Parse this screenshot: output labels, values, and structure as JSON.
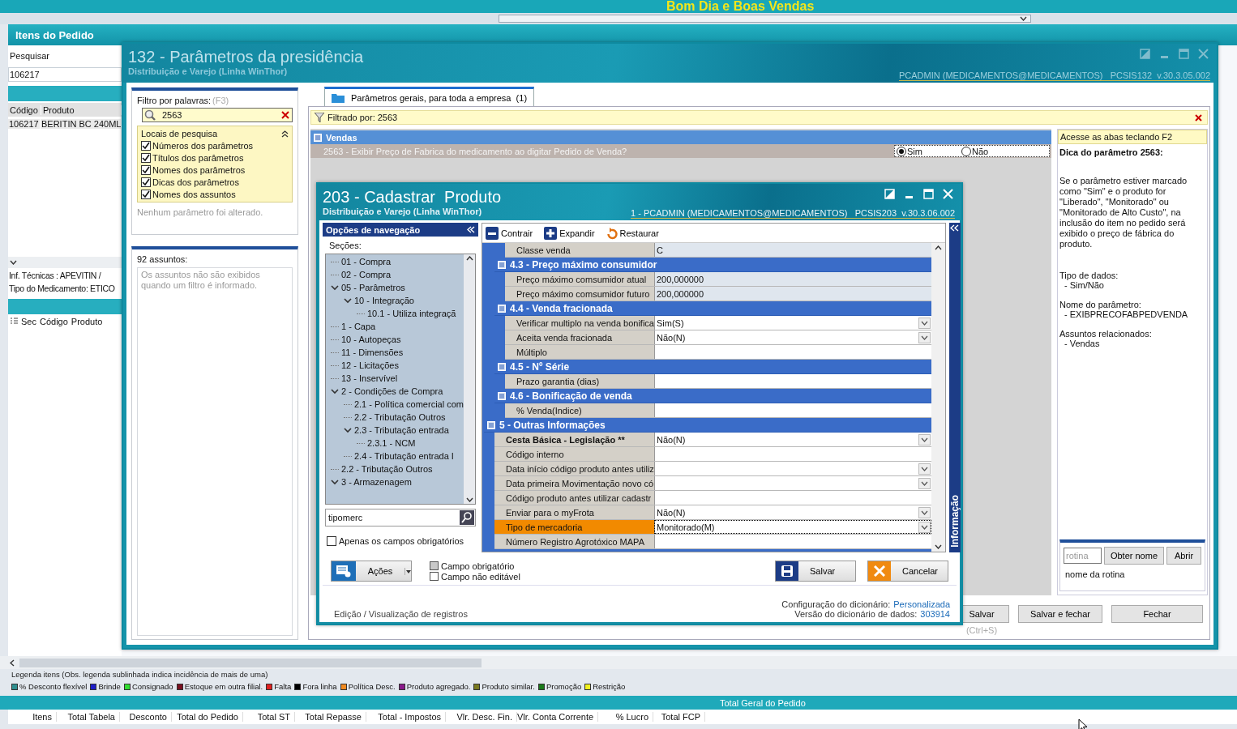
{
  "banner": {
    "title": "Bom Dia e Boas Vendas"
  },
  "background": {
    "header": "Itens do Pedido",
    "search_label": "Pesquisar",
    "search_value": "106217",
    "table": {
      "columns": [
        "Código",
        "Produto"
      ],
      "rows": [
        [
          "106217",
          "BERITIN BC 240ML"
        ]
      ]
    },
    "info": [
      "Inf. Técnicas : APEVITIN /",
      "Tipo do Medicamento: ETICO"
    ],
    "table2": {
      "columns": [
        "Sec",
        "Código",
        "Produto"
      ]
    }
  },
  "legend": {
    "title": "Legenda itens (Obs. legenda sublinhada indica incidência de mais de uma)",
    "items": [
      {
        "label": "% Desconto flexível",
        "color": "#2f8f8f"
      },
      {
        "label": "Brinde",
        "color": "#1e1ec8"
      },
      {
        "label": "Consignado",
        "color": "#33dd33"
      },
      {
        "label": "Estoque em outra filial.",
        "color": "#7a1020"
      },
      {
        "label": "Falta",
        "color": "#e02020"
      },
      {
        "label": "Fora linha",
        "color": "#000000"
      },
      {
        "label": "Política Desc.",
        "color": "#f08a20"
      },
      {
        "label": "Produto agregado.",
        "color": "#8a1a8a"
      },
      {
        "label": "Produto similar.",
        "color": "#7a7a20"
      },
      {
        "label": "Promoção",
        "color": "#1a7a1a"
      },
      {
        "label": "Restrição",
        "color": "#f0f020"
      }
    ]
  },
  "totals": {
    "title": "Total Geral do Pedido",
    "columns": [
      "Itens",
      "Total Tabela",
      "Desconto",
      "Total do Pedido",
      "Total ST",
      "Total Repasse",
      "Total - Impostos",
      "Vlr. Desc. Fin.",
      "Vlr. Conta Corrente",
      "% Lucro",
      "Total FCP"
    ]
  },
  "params_window": {
    "title": "132 - Parâmetros da presidência",
    "subtitle": "Distribuição e Varejo (Linha WinThor)",
    "user": "PCADMIN (MEDICAMENTOS@MEDICAMENTOS)   PCSIS132  v.30.3.05.002",
    "filter": {
      "label": "Filtro por palavras:",
      "hint": "(F3)",
      "value": "2563",
      "places_title": "Locais de pesquisa",
      "places": [
        {
          "label": "Números dos parâmetros",
          "checked": true
        },
        {
          "label": "Títulos dos parâmetros",
          "checked": true
        },
        {
          "label": "Nomes dos parâmetros",
          "checked": true
        },
        {
          "label": "Dicas dos parâmetros",
          "checked": true
        },
        {
          "label": "Nomes dos assuntos",
          "checked": true
        }
      ],
      "note": "Nenhum parâmetro foi alterado."
    },
    "subjects": {
      "count": "92 assuntos:",
      "note": "Os assuntos não são exibidos quando um filtro é informado."
    },
    "tabs": [
      {
        "label": "Parâmetros gerais, para toda a empresa  (1)",
        "selected": true
      }
    ],
    "filtered_by": "Filtrado por: 2563",
    "groups": [
      {
        "title": "Vendas",
        "params": [
          {
            "label": "2563 - Exibir Preço de Fabrica do medicamento ao digitar Pedido de Venda?",
            "options": [
              {
                "label": "Sim",
                "selected": true
              },
              {
                "label": "Não",
                "selected": false
              }
            ]
          }
        ]
      }
    ],
    "tip": {
      "hint": "Acesse as abas teclando F2",
      "title": "Dica do parâmetro 2563:",
      "body": "Se o parâmetro estiver marcado como \"Sim\" e o produto for \"Liberado\", \"Monitorado\" ou \"Monitorado de Alto Custo\", na inclusão do item no pedido será exibido o preço de fábrica do produto.",
      "sections": [
        {
          "label": "Tipo de dados:",
          "value": "- Sim/Não"
        },
        {
          "label": "Nome do parâmetro:",
          "value": "- EXIBPRECOFABPEDVENDA"
        },
        {
          "label": "Assuntos relacionados:",
          "value": "- Vendas"
        }
      ]
    },
    "rotina": {
      "placeholder": "rotina",
      "buttons": [
        "Obter nome",
        "Abrir"
      ],
      "name": "nome da rotina"
    },
    "buttons": [
      {
        "label": "Salvar",
        "shortcut": "(Ctrl+S)"
      },
      {
        "label": "Salvar e fechar"
      },
      {
        "label": "Fechar"
      }
    ]
  },
  "product_window": {
    "title": "203 - Cadastrar  Produto",
    "subtitle": "Distribuição e Varejo (Linha WinThor)",
    "user": "1 - PCADMIN (MEDICAMENTOS@MEDICAMENTOS)   PCSIS203  v.30.3.06.002",
    "nav": {
      "title": "Opções de navegação",
      "sections_label": "Seções:",
      "tree": [
        {
          "label": "01 - Compra"
        },
        {
          "label": "02 - Compra"
        },
        {
          "label": "05 - Parâmetros",
          "expanded": true,
          "children": [
            {
              "label": "10 - Integração",
              "expanded": true,
              "children": [
                {
                  "label": "10.1 - Utiliza integraçã"
                }
              ]
            }
          ]
        },
        {
          "label": "1 - Capa"
        },
        {
          "label": "10 - Autopeças"
        },
        {
          "label": "11 - Dimensões"
        },
        {
          "label": "12 - Licitações"
        },
        {
          "label": "13 - Inservível"
        },
        {
          "label": "2 - Condições de Compra",
          "expanded": true,
          "children": [
            {
              "label": "2.1 - Política comercial com"
            },
            {
              "label": "2.2 - Tributação Outros"
            },
            {
              "label": "2.3 - Tributação entrada",
              "expanded": true,
              "children": [
                {
                  "label": "2.3.1 - NCM"
                }
              ]
            },
            {
              "label": "2.4 - Tributação entrada I"
            }
          ]
        },
        {
          "label": "2.2 - Tributação Outros"
        },
        {
          "label": "3 - Armazenagem",
          "expanded": true
        }
      ],
      "search": "tipomerc",
      "only_required": {
        "label": "Apenas os campos obrigatórios",
        "checked": false
      },
      "actions": "Ações",
      "legend": [
        {
          "label": "Campo obrigatório",
          "kind": "required"
        },
        {
          "label": "Campo não editável",
          "kind": "readonly"
        }
      ],
      "status": "Edição / Visualização de registros"
    },
    "toolbar": [
      {
        "label": "Contrair",
        "kind": "collapse"
      },
      {
        "label": "Expandir",
        "kind": "expand"
      },
      {
        "label": "Restaurar",
        "kind": "restore"
      }
    ],
    "grid": [
      {
        "kind": "readonly",
        "label": "Classe venda",
        "value": "C",
        "required": false,
        "selected": false
      },
      {
        "kind": "subgroup",
        "title": "4.3 - Preço máximo consumidor"
      },
      {
        "kind": "readonly",
        "label": "Preço máximo comsumidor atual",
        "value": "200,000000",
        "required": false,
        "selected": false
      },
      {
        "kind": "readonly",
        "label": "Preço máximo comsumidor futuro",
        "value": "200,000000",
        "required": false,
        "selected": false
      },
      {
        "kind": "subgroup",
        "title": "4.4 - Venda fracionada"
      },
      {
        "kind": "combo",
        "label": "Verificar multiplo na venda bonifica",
        "value": "Sim(S)",
        "required": false,
        "selected": false
      },
      {
        "kind": "combo",
        "label": "Aceita venda fracionada",
        "value": "Não(N)",
        "required": false,
        "selected": false
      },
      {
        "kind": "text",
        "label": "Múltiplo",
        "required": false,
        "selected": false
      },
      {
        "kind": "subgroup",
        "title": "4.5 - Nº Série"
      },
      {
        "kind": "text",
        "label": "Prazo garantia (dias)",
        "required": false,
        "selected": false
      },
      {
        "kind": "subgroup",
        "title": "4.6 - Bonificação de venda"
      },
      {
        "kind": "text",
        "label": "% Venda(Indice)",
        "required": false,
        "selected": false
      },
      {
        "kind": "group",
        "title": "5 - Outras Informações"
      },
      {
        "kind": "combo",
        "label": "Cesta Básica - Legislação **",
        "value": "Não(N)",
        "required": true,
        "selected": false
      },
      {
        "kind": "text",
        "label": "Código interno",
        "required": false,
        "selected": false
      },
      {
        "kind": "combo",
        "label": "Data início código produto antes utiliz",
        "required": false,
        "selected": false
      },
      {
        "kind": "combo",
        "label": "Data primeira Movimentação novo có",
        "required": false,
        "selected": false
      },
      {
        "kind": "text",
        "label": "Código produto antes utilizar cadastr",
        "required": false,
        "selected": false
      },
      {
        "kind": "combo",
        "label": "Enviar para o myFrota",
        "value": "Não(N)",
        "required": false,
        "selected": false
      },
      {
        "kind": "combo",
        "label": "Tipo de mercadoria",
        "value": "Monitorado(M)",
        "required": false,
        "selected": true
      },
      {
        "kind": "text",
        "label": "Número Registro Agrotóxico MAPA",
        "required": false,
        "selected": false
      }
    ],
    "side_tab": "Informação",
    "buttons": [
      {
        "label": "Salvar",
        "kind": "save"
      },
      {
        "label": "Cancelar",
        "kind": "cancel"
      }
    ],
    "dictionary": [
      {
        "label": "Configuração do dicionário:",
        "value": "Personalizada"
      },
      {
        "label": "Versão do dicionário de dados:",
        "value": "303914"
      }
    ]
  }
}
